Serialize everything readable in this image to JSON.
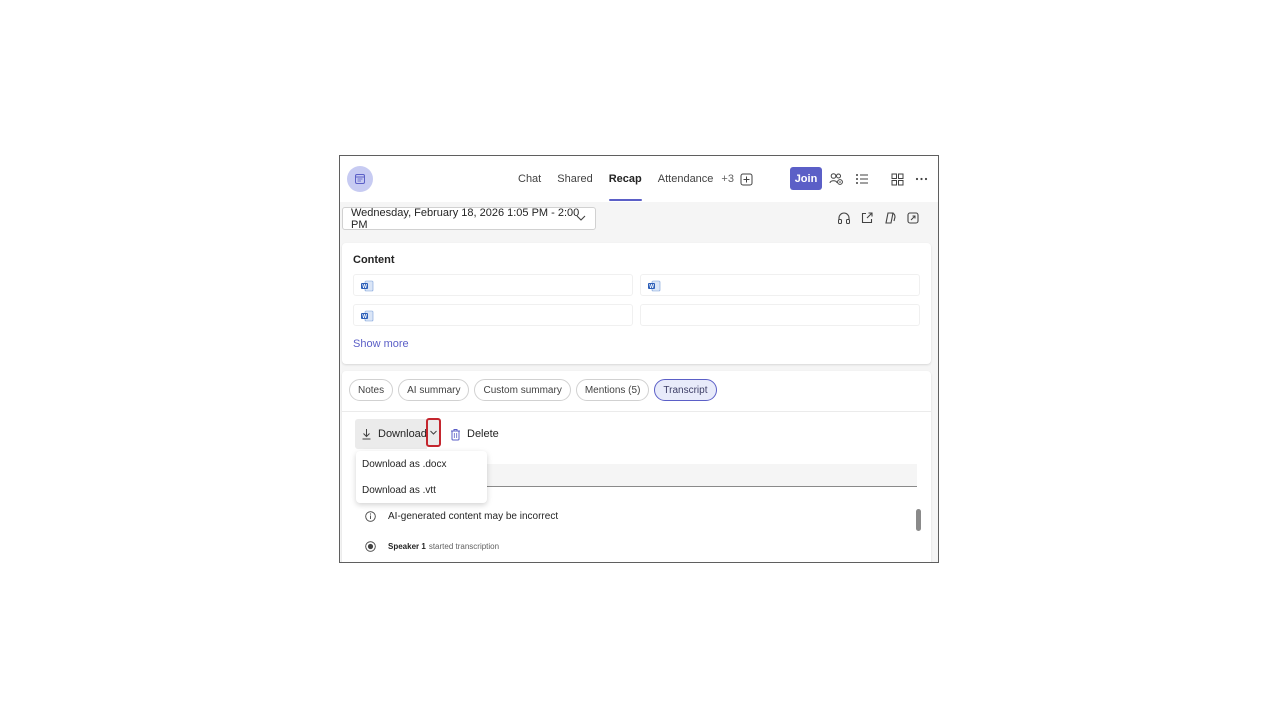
{
  "topbar": {
    "tabs": [
      {
        "label": "Chat"
      },
      {
        "label": "Shared"
      },
      {
        "label": "Recap"
      },
      {
        "label": "Attendance"
      }
    ],
    "more_tabs": "+3",
    "join_label": "Join",
    "active_tab": "Recap",
    "icons": [
      "calendar-icon",
      "add-tab-icon",
      "people-settings-icon",
      "list-icon",
      "apps-icon",
      "more-icon"
    ]
  },
  "meeting": {
    "date_range": "Wednesday, February 18, 2026 1:05 PM - 2:00 PM",
    "actions": [
      "headphones-icon",
      "share-icon",
      "copilot-icon",
      "open-external-icon"
    ]
  },
  "content": {
    "title": "Content",
    "show_more": "Show more"
  },
  "recap_tabs": [
    {
      "label": "Notes"
    },
    {
      "label": "AI summary"
    },
    {
      "label": "Custom summary"
    },
    {
      "label": "Mentions (5)"
    },
    {
      "label": "Transcript"
    }
  ],
  "transcript": {
    "download_label": "Download",
    "delete_label": "Delete",
    "menu": [
      {
        "label": "Download as .docx"
      },
      {
        "label": "Download as .vtt"
      }
    ],
    "info": "AI-generated content may be incorrect",
    "speaker": "Speaker 1",
    "speaker_action": "started transcription"
  },
  "colors": {
    "accent": "#5b5fc7",
    "highlight_border": "#c4262e"
  }
}
